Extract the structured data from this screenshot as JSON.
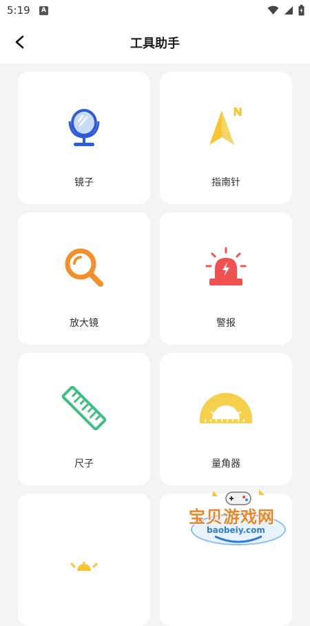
{
  "status_bar": {
    "time": "5:19",
    "notification_icon_letter": "A",
    "icons": [
      "wifi-icon",
      "signal-icon",
      "battery-icon"
    ]
  },
  "header": {
    "title": "工具助手",
    "back_icon": "chevron-left-icon"
  },
  "tools": [
    {
      "label": "镜子",
      "icon": "mirror-icon",
      "color": "#2f5bd9"
    },
    {
      "label": "指南针",
      "icon": "compass-icon",
      "color": "#f7c531"
    },
    {
      "label": "放大镜",
      "icon": "magnifier-icon",
      "color": "#f4902c"
    },
    {
      "label": "警报",
      "icon": "alarm-icon",
      "color": "#f05252"
    },
    {
      "label": "尺子",
      "icon": "ruler-icon",
      "color": "#3bbf83"
    },
    {
      "label": "量角器",
      "icon": "protractor-icon",
      "color": "#f5d04c"
    },
    {
      "label": "",
      "icon": "sun-icon",
      "color": "#f7c531"
    },
    {
      "label": "",
      "icon": "",
      "color": ""
    }
  ],
  "watermark": {
    "text": "宝贝游戏网",
    "url": "baobeiy.com"
  }
}
